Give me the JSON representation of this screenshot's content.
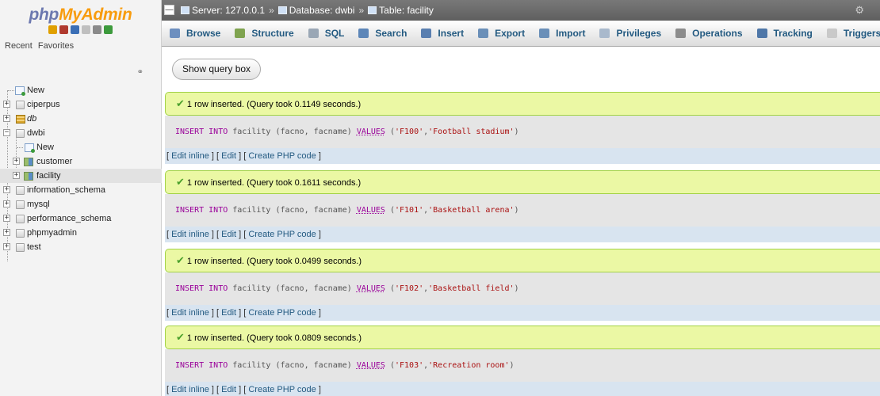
{
  "logo": {
    "part1": "php",
    "part2": "MyAdmin"
  },
  "logo_icons": [
    {
      "name": "home-icon",
      "color": "#e0a000"
    },
    {
      "name": "exit-icon",
      "color": "#b03a2e"
    },
    {
      "name": "help-icon",
      "color": "#3b6fb6"
    },
    {
      "name": "docs-icon",
      "color": "#bfbfbf"
    },
    {
      "name": "settings-icon",
      "color": "#8a8a8a"
    },
    {
      "name": "reload-icon",
      "color": "#3c9a3c"
    }
  ],
  "nav_tabs": [
    "Recent",
    "Favorites"
  ],
  "tree": {
    "new_root": "New",
    "databases": [
      "ciperpus",
      "db",
      "dwbi",
      "information_schema",
      "mysql",
      "performance_schema",
      "phpmyadmin",
      "test"
    ],
    "dwbi_children": [
      "New",
      "customer",
      "facility"
    ]
  },
  "topbar": {
    "server": "Server: 127.0.0.1",
    "database": "Database: dwbi",
    "table": "Table: facility"
  },
  "menu": [
    {
      "label": "Browse",
      "icon": "browse-icon",
      "color": "#6d8fbf"
    },
    {
      "label": "Structure",
      "icon": "structure-icon",
      "color": "#7fa34f"
    },
    {
      "label": "SQL",
      "icon": "sql-icon",
      "color": "#9aa7b5"
    },
    {
      "label": "Search",
      "icon": "search-icon",
      "color": "#5d86b8"
    },
    {
      "label": "Insert",
      "icon": "insert-icon",
      "color": "#5a7fb0"
    },
    {
      "label": "Export",
      "icon": "export-icon",
      "color": "#6a8fb8"
    },
    {
      "label": "Import",
      "icon": "import-icon",
      "color": "#6a8fb8"
    },
    {
      "label": "Privileges",
      "icon": "privileges-icon",
      "color": "#a9b9cc"
    },
    {
      "label": "Operations",
      "icon": "operations-icon",
      "color": "#8c8c8c"
    },
    {
      "label": "Tracking",
      "icon": "tracking-icon",
      "color": "#4f77a8"
    },
    {
      "label": "Triggers",
      "icon": "triggers-icon",
      "color": "#c9c9c9"
    }
  ],
  "show_query_label": "Show query box",
  "results": [
    {
      "message": "1 row inserted. (Query took 0.1149 seconds.)",
      "facno": "'F100'",
      "facname": "'Football stadium'"
    },
    {
      "message": "1 row inserted. (Query took 0.1611 seconds.)",
      "facno": "'F101'",
      "facname": "'Basketball arena'"
    },
    {
      "message": "1 row inserted. (Query took 0.0499 seconds.)",
      "facno": "'F102'",
      "facname": "'Basketball field'"
    },
    {
      "message": "1 row inserted. (Query took 0.0809 seconds.)",
      "facno": "'F103'",
      "facname": "'Recreation room'"
    }
  ],
  "sql_parts": {
    "insert": "INSERT",
    "into": "INTO",
    "table_cols": " facility (facno, facname) ",
    "values": "VALUES",
    "open": " (",
    "comma": ",",
    "close": ")"
  },
  "result_links": {
    "edit_inline": "Edit inline",
    "edit": "Edit",
    "create_php": "Create PHP code"
  },
  "colors": {
    "success_bg": "#ebf8a4",
    "success_border": "#a2d246",
    "link": "#235a81",
    "sql_keyword": "#990099",
    "sql_string": "#aa1111"
  }
}
